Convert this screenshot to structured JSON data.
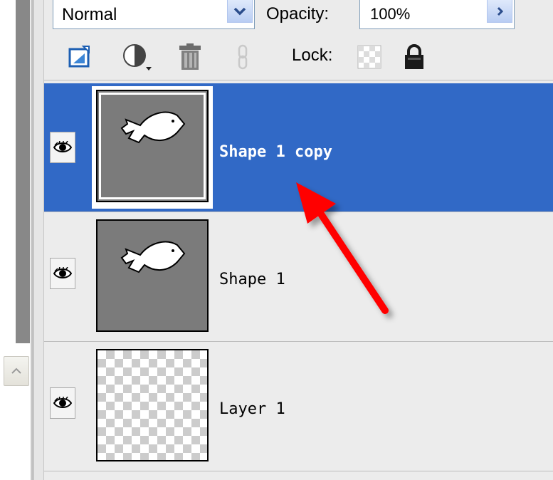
{
  "toolbar": {
    "blend_mode": "Normal",
    "opacity_label": "Opacity:",
    "opacity_value": "100%",
    "lock_label": "Lock:"
  },
  "layers": [
    {
      "name": "Shape 1 copy",
      "selected": true,
      "visible": true,
      "thumbnail": "fish-shape"
    },
    {
      "name": "Shape 1",
      "selected": false,
      "visible": true,
      "thumbnail": "fish-shape"
    },
    {
      "name": "Layer 1",
      "selected": false,
      "visible": true,
      "thumbnail": "transparent"
    }
  ],
  "colors": {
    "selection": "#3169c6",
    "annotation_arrow": "#ff0000"
  },
  "icons": {
    "new_layer": "new-layer-icon",
    "adjustment_layer": "adjustment-layer-icon",
    "delete": "trash-icon",
    "link": "link-icon",
    "lock_transparency": "lock-transparency-icon",
    "lock_all": "lock-icon",
    "visibility": "eye-icon"
  }
}
